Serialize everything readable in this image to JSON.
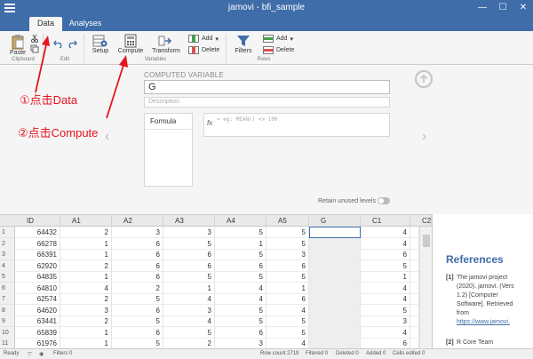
{
  "window": {
    "title": "jamovi - bfi_sample",
    "minimize": "—",
    "maximize": "☐",
    "close": "✕"
  },
  "tabs": [
    {
      "label": "Data",
      "active": true
    },
    {
      "label": "Analyses",
      "active": false
    }
  ],
  "ribbon": {
    "paste": "Paste",
    "clipboard_group": "Clipboard",
    "edit_group": "Edit",
    "setup": "Setup",
    "compute": "Compute",
    "transform": "Transform",
    "variables_group": "Variables",
    "add": "Add",
    "delete": "Delete",
    "filters": "Filters",
    "rows_add": "Add",
    "rows_delete": "Delete",
    "rows_group": "Rows"
  },
  "annotations": {
    "step1": "①点击Data",
    "step2": "②点击Compute"
  },
  "computed": {
    "heading": "COMPUTED VARIABLE",
    "name": "G",
    "description_placeholder": "Description",
    "formula_label": "Formula",
    "fx_label": "fx",
    "formula_example": "= eg: MEAN() <> 100",
    "retain_label": "Retain unused levels"
  },
  "grid": {
    "columns": [
      "ID",
      "A1",
      "A2",
      "A3",
      "A4",
      "A5",
      "G",
      "C1",
      "C2"
    ],
    "rows": [
      [
        "64432",
        "2",
        "3",
        "3",
        "5",
        "5",
        "",
        "4"
      ],
      [
        "66278",
        "1",
        "6",
        "5",
        "1",
        "5",
        "",
        "4"
      ],
      [
        "66391",
        "1",
        "6",
        "6",
        "5",
        "3",
        "",
        "6"
      ],
      [
        "62920",
        "2",
        "6",
        "6",
        "6",
        "6",
        "",
        "5"
      ],
      [
        "64835",
        "1",
        "6",
        "5",
        "5",
        "5",
        "",
        "1"
      ],
      [
        "64810",
        "4",
        "2",
        "1",
        "4",
        "1",
        "",
        "4"
      ],
      [
        "62574",
        "2",
        "5",
        "4",
        "4",
        "6",
        "",
        "4"
      ],
      [
        "64620",
        "3",
        "6",
        "3",
        "5",
        "4",
        "",
        "5"
      ],
      [
        "63441",
        "2",
        "5",
        "4",
        "5",
        "5",
        "",
        "3"
      ],
      [
        "65839",
        "1",
        "6",
        "5",
        "6",
        "5",
        "",
        "4"
      ],
      [
        "61976",
        "1",
        "5",
        "2",
        "3",
        "4",
        "",
        "6"
      ]
    ]
  },
  "references": {
    "heading": "References",
    "ref1_num": "[1]",
    "ref1_lines": [
      "The jamovi project",
      "(2020). jamovi. (Vers",
      "1.2) [Computer",
      "Software]. Retrieved",
      "from"
    ],
    "ref1_link": "https://www.jamovi.",
    "ref2_num": "[2]",
    "ref2_text": "R Core Team"
  },
  "status": {
    "ready": "Ready",
    "filters": "Filters 0",
    "row_count": "Row count 2719",
    "filtered": "Filtered 0",
    "deleted": "Deleted 0",
    "added": "Added 0",
    "cells_edited": "Cells edited 0"
  },
  "colors": {
    "brand": "#3e6da9",
    "annotation": "#e5141e"
  }
}
